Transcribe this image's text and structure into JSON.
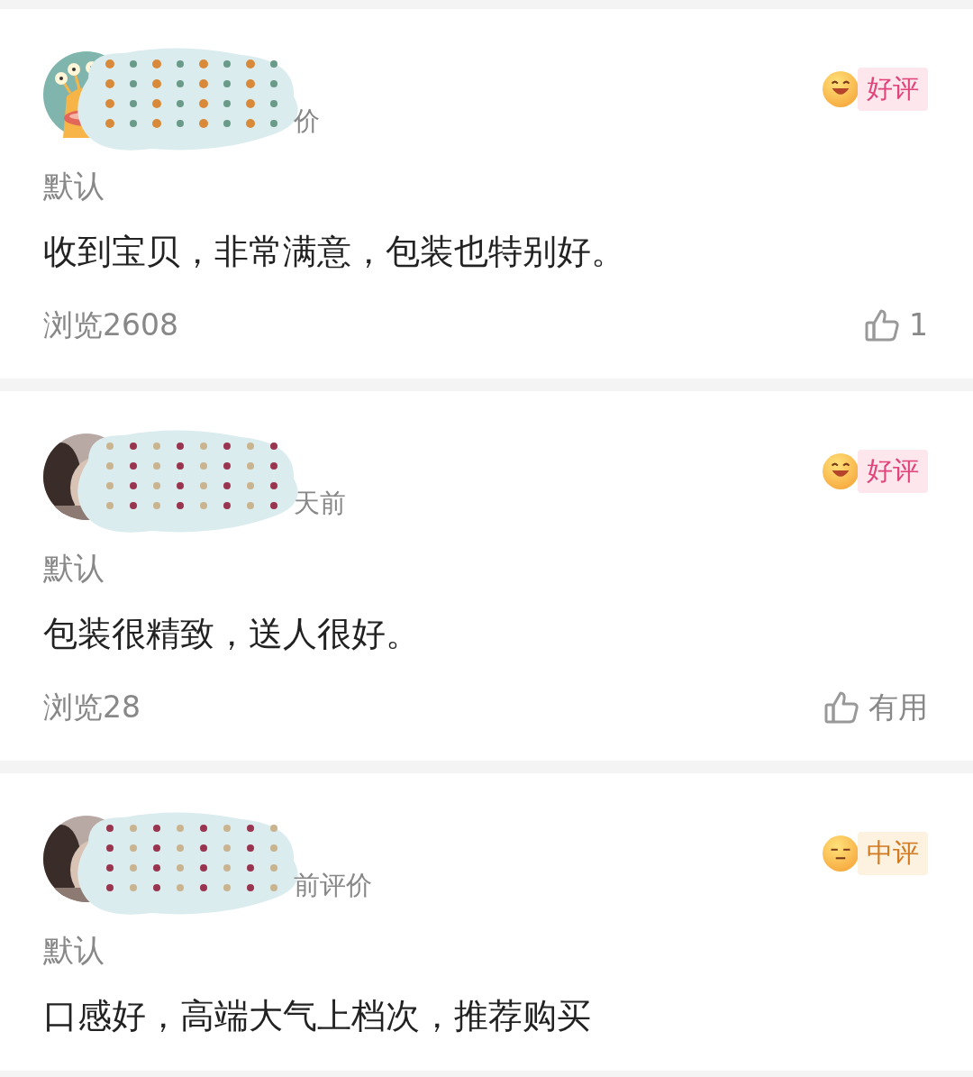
{
  "reviews": [
    {
      "avatar": {
        "kind": "cartoon"
      },
      "date_fragment": "价",
      "rating": {
        "kind": "good",
        "label": "好评"
      },
      "spec": "默认",
      "text": "收到宝贝，非常满意，包装也特别好。",
      "views": "浏览2608",
      "like": "1"
    },
    {
      "date_fragment": "天前",
      "rating": {
        "kind": "good",
        "label": "好评"
      },
      "spec": "默认",
      "text": "包装很精致，送人很好。",
      "views": "浏览28",
      "like": "有用"
    },
    {
      "date_fragment": "前评价",
      "rating": {
        "kind": "neutral",
        "label": "中评"
      },
      "spec": "默认",
      "text": "口感好，高端大气上档次，推荐购买"
    }
  ]
}
